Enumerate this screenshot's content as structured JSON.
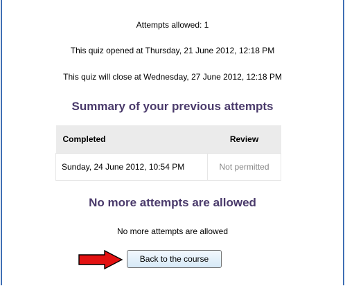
{
  "quiz_info": {
    "attempts_allowed": "Attempts allowed: 1",
    "opened": "This quiz opened at Thursday, 21 June 2012, 12:18 PM",
    "close": "This quiz will close at Wednesday, 27 June 2012, 12:18 PM"
  },
  "summary": {
    "heading": "Summary of your previous attempts",
    "columns": [
      "Completed",
      "Review"
    ],
    "rows": [
      {
        "completed": "Sunday, 24 June 2012, 10:54 PM",
        "review": "Not permitted"
      }
    ]
  },
  "no_more": {
    "heading": "No more attempts are allowed",
    "message": "No more attempts are allowed"
  },
  "back_button_label": "Back to the course",
  "colors": {
    "heading": "#4a3a6b",
    "frame_border": "#3f6fb4",
    "arrow_fill": "#e31212",
    "table_header_bg": "#ebebeb",
    "muted_text": "#888888"
  }
}
